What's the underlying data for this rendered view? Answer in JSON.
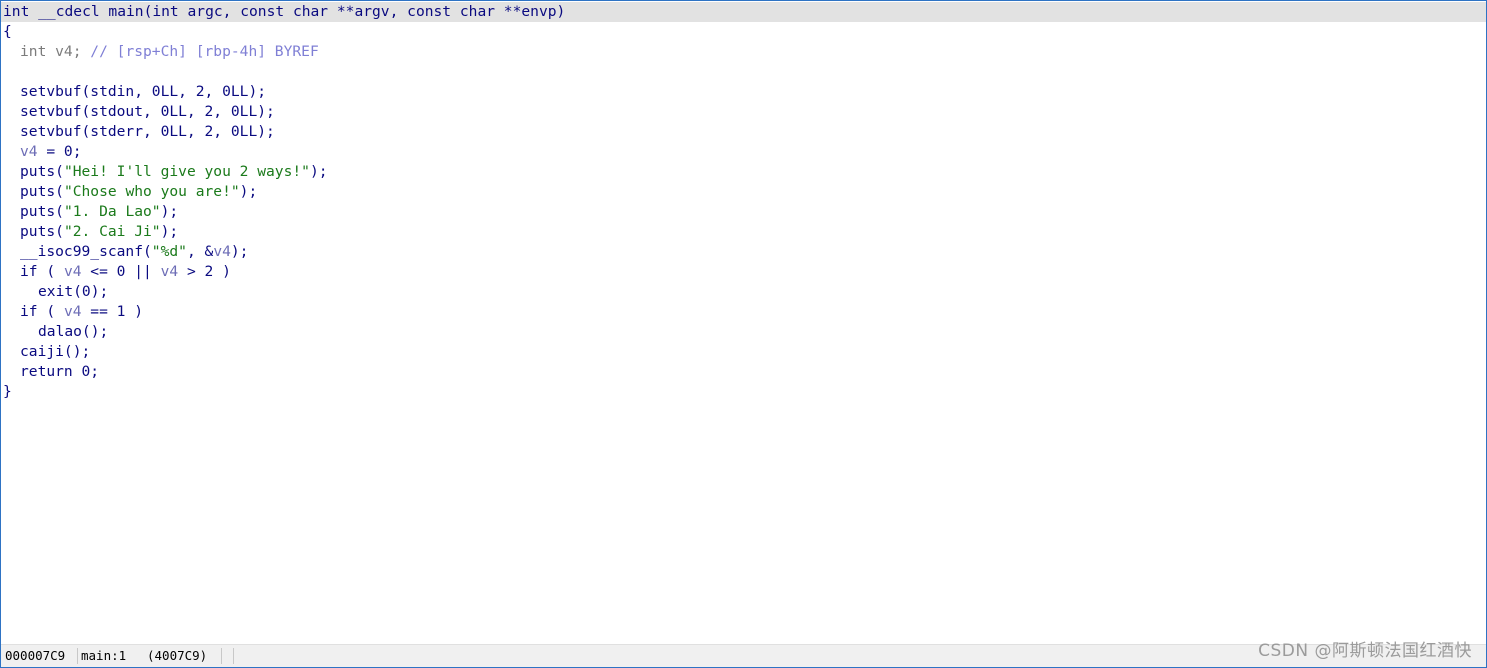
{
  "code": {
    "signature": "int __cdecl main(int argc, const char **argv, const char **envp)",
    "open_brace": "{",
    "decl_type": "int v4;",
    "decl_comment": " // [rsp+Ch] [rbp-4h] BYREF",
    "setvbuf_stdin": "setvbuf(stdin, 0LL, 2, 0LL);",
    "setvbuf_stdout": "setvbuf(stdout, 0LL, 2, 0LL);",
    "setvbuf_stderr": "setvbuf(stderr, 0LL, 2, 0LL);",
    "v4_var": "v4",
    "assign_rest": " = 0;",
    "puts_fn": "puts(",
    "str1": "\"Hei! I'll give you 2 ways!\"",
    "str2": "\"Chose who you are!\"",
    "str3": "\"1. Da Lao\"",
    "str4": "\"2. Cai Ji\"",
    "call_end": ");",
    "scanf_fn": "__isoc99_scanf(",
    "scanf_fmt": "\"%d\"",
    "scanf_mid": ", &",
    "if1_start": "if ( ",
    "if1_mid1": " <= 0 || ",
    "if1_end": " > 2 )",
    "exit_call": "exit(0);",
    "if2_start": "if ( ",
    "if2_end": " == 1 )",
    "dalao_call": "dalao();",
    "caiji_call": "caiji();",
    "return_stmt": "return 0;",
    "close_brace": "}"
  },
  "status": {
    "offset": "000007C9",
    "location": "main:1",
    "address": "(4007C9)"
  },
  "watermark": "CSDN @阿斯顿法国红酒快",
  "colors": {
    "border": "#2e73c4",
    "keyword": "#0a0a80",
    "string": "#1b7a1b",
    "variable": "#6d6db6",
    "comment": "#7f7fd5"
  }
}
